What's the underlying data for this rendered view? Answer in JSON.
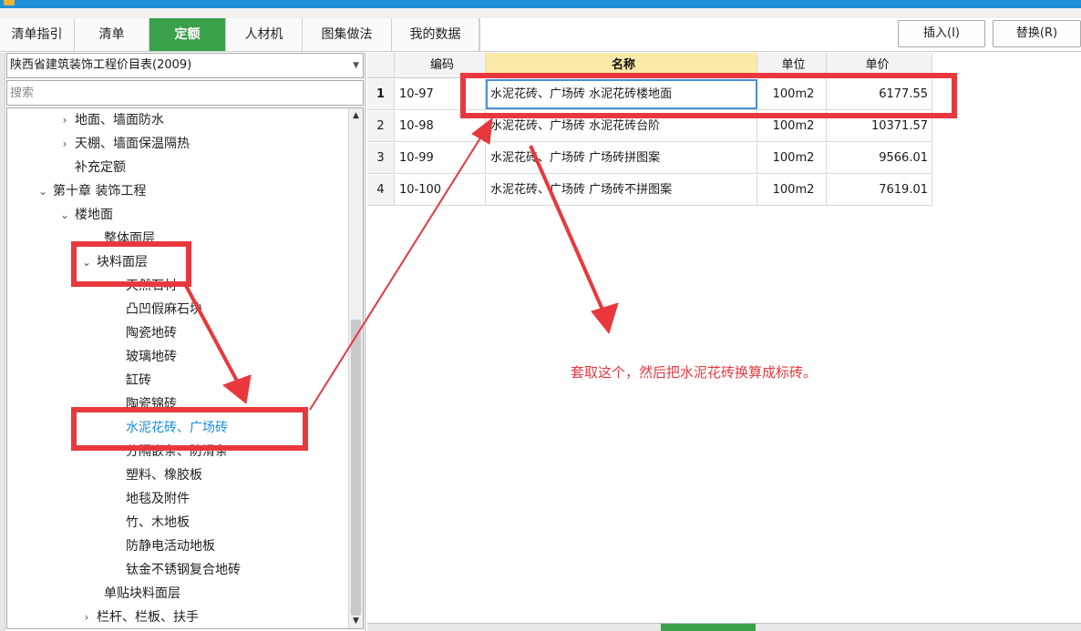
{
  "window": {
    "title": ""
  },
  "tabs": [
    {
      "label": "清单指引",
      "active": false
    },
    {
      "label": "清单",
      "active": false
    },
    {
      "label": "定额",
      "active": true
    },
    {
      "label": "人材机",
      "active": false
    },
    {
      "label": "图集做法",
      "active": false
    },
    {
      "label": "我的数据",
      "active": false
    }
  ],
  "toolbar": {
    "insert_label": "插入(I)",
    "replace_label": "替换(R)"
  },
  "library": {
    "selected": "陕西省建筑装饰工程价目表(2009)"
  },
  "search": {
    "placeholder": "搜索",
    "value": ""
  },
  "tree": [
    {
      "label": "地面、墙面防水",
      "chevron": "›"
    },
    {
      "label": "天棚、墙面保温隔热",
      "chevron": "›"
    },
    {
      "label": "补充定额",
      "chevron": ""
    },
    {
      "label": "第十章 装饰工程",
      "chevron": "⌄"
    },
    {
      "label": "楼地面",
      "chevron": "⌄"
    },
    {
      "label": "整体面层",
      "chevron": ""
    },
    {
      "label": "块料面层",
      "chevron": "⌄"
    },
    {
      "label": "天然石材",
      "chevron": ""
    },
    {
      "label": "凸凹假麻石块",
      "chevron": ""
    },
    {
      "label": "陶瓷地砖",
      "chevron": ""
    },
    {
      "label": "玻璃地砖",
      "chevron": ""
    },
    {
      "label": "缸砖",
      "chevron": ""
    },
    {
      "label": "陶瓷锦砖",
      "chevron": ""
    },
    {
      "label": "水泥花砖、广场砖",
      "chevron": "",
      "selected": true
    },
    {
      "label": "分隔嵌条、防滑条",
      "chevron": ""
    },
    {
      "label": "塑料、橡胶板",
      "chevron": ""
    },
    {
      "label": "地毯及附件",
      "chevron": ""
    },
    {
      "label": "竹、木地板",
      "chevron": ""
    },
    {
      "label": "防静电活动地板",
      "chevron": ""
    },
    {
      "label": "钛金不锈钢复合地砖",
      "chevron": ""
    },
    {
      "label": "单贴块料面层",
      "chevron": ""
    },
    {
      "label": "栏杆、栏板、扶手",
      "chevron": "›"
    }
  ],
  "grid": {
    "headers": {
      "code": "编码",
      "name": "名称",
      "unit": "单位",
      "price": "单价"
    },
    "rows": [
      {
        "index": "1",
        "code": "10-97",
        "name": "水泥花砖、广场砖 水泥花砖楼地面",
        "unit": "100m2",
        "price": "6177.55",
        "current": true
      },
      {
        "index": "2",
        "code": "10-98",
        "name": "水泥花砖、广场砖 水泥花砖台阶",
        "unit": "100m2",
        "price": "10371.57"
      },
      {
        "index": "3",
        "code": "10-99",
        "name": "水泥花砖、广场砖 广场砖拼图案",
        "unit": "100m2",
        "price": "9566.01"
      },
      {
        "index": "4",
        "code": "10-100",
        "name": "水泥花砖、广场砖 广场砖不拼图案",
        "unit": "100m2",
        "price": "7619.01"
      }
    ]
  },
  "annotation": {
    "note": "套取这个，然后把水泥花砖换算成标砖。",
    "color": "#e8383d"
  },
  "colors": {
    "accent_tab": "#3aa04a",
    "title_bar": "#1e90d9",
    "selected_tree_text": "#1a8ee0"
  }
}
